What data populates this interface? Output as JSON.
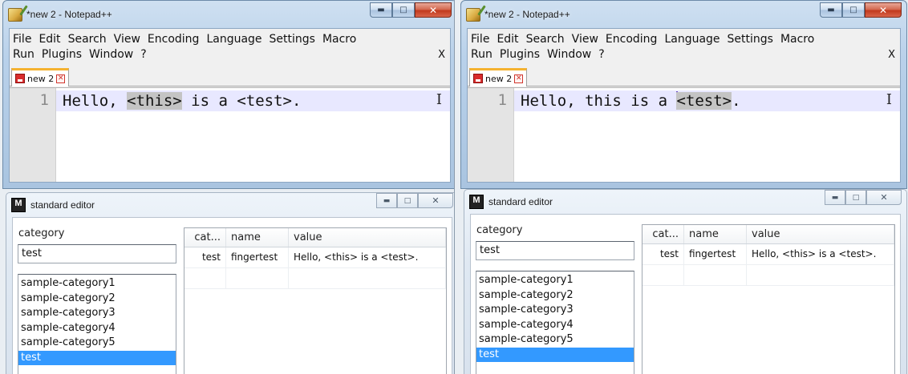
{
  "panes": [
    {
      "notepad": {
        "title": "*new  2 - Notepad++",
        "menu_row1": [
          "File",
          "Edit",
          "Search",
          "View",
          "Encoding",
          "Language",
          "Settings",
          "Macro"
        ],
        "menu_row2": [
          "Run",
          "Plugins",
          "Window",
          "?"
        ],
        "close_doc": "X",
        "tab_label": "new 2",
        "line_number": "1",
        "code_before": "Hello, ",
        "code_highlight": "<this>",
        "code_after": " is a <test>.",
        "caret_before_highlight": false
      },
      "editor": {
        "title": "standard editor",
        "logo_text": "M",
        "category_label": "category",
        "category_value": "test",
        "categories": [
          "sample-category1",
          "sample-category2",
          "sample-category3",
          "sample-category4",
          "sample-category5",
          "test"
        ],
        "selected_category": "test",
        "columns": [
          "cat...",
          "name",
          "value"
        ],
        "rows": [
          [
            "test",
            "fingertest",
            "Hello, <this> is a <test>."
          ]
        ]
      }
    },
    {
      "notepad": {
        "title": "*new  2 - Notepad++",
        "menu_row1": [
          "File",
          "Edit",
          "Search",
          "View",
          "Encoding",
          "Language",
          "Settings",
          "Macro"
        ],
        "menu_row2": [
          "Run",
          "Plugins",
          "Window",
          "?"
        ],
        "close_doc": "X",
        "tab_label": "new 2",
        "line_number": "1",
        "code_before": "Hello, this is a ",
        "code_highlight": "<test>",
        "code_after": ".",
        "caret_before_highlight": true
      },
      "editor": {
        "title": "standard editor",
        "logo_text": "M",
        "category_label": "category",
        "category_value": "test",
        "categories": [
          "sample-category1",
          "sample-category2",
          "sample-category3",
          "sample-category4",
          "sample-category5",
          "test"
        ],
        "selected_category": "test",
        "columns": [
          "cat...",
          "name",
          "value"
        ],
        "rows": [
          [
            "test",
            "fingertest",
            "Hello, <this> is a <test>."
          ]
        ]
      }
    }
  ],
  "colors": {
    "selection": "#3399ff",
    "current_line": "#e8e8ff",
    "highlight": "#c4c4c4",
    "close_button": "#c23a1e"
  },
  "icons": [
    "notepadpp-icon",
    "minimize-icon",
    "maximize-icon",
    "close-icon",
    "save-state-icon",
    "tab-close-icon",
    "ibeam-cursor-icon",
    "m-logo-icon"
  ]
}
